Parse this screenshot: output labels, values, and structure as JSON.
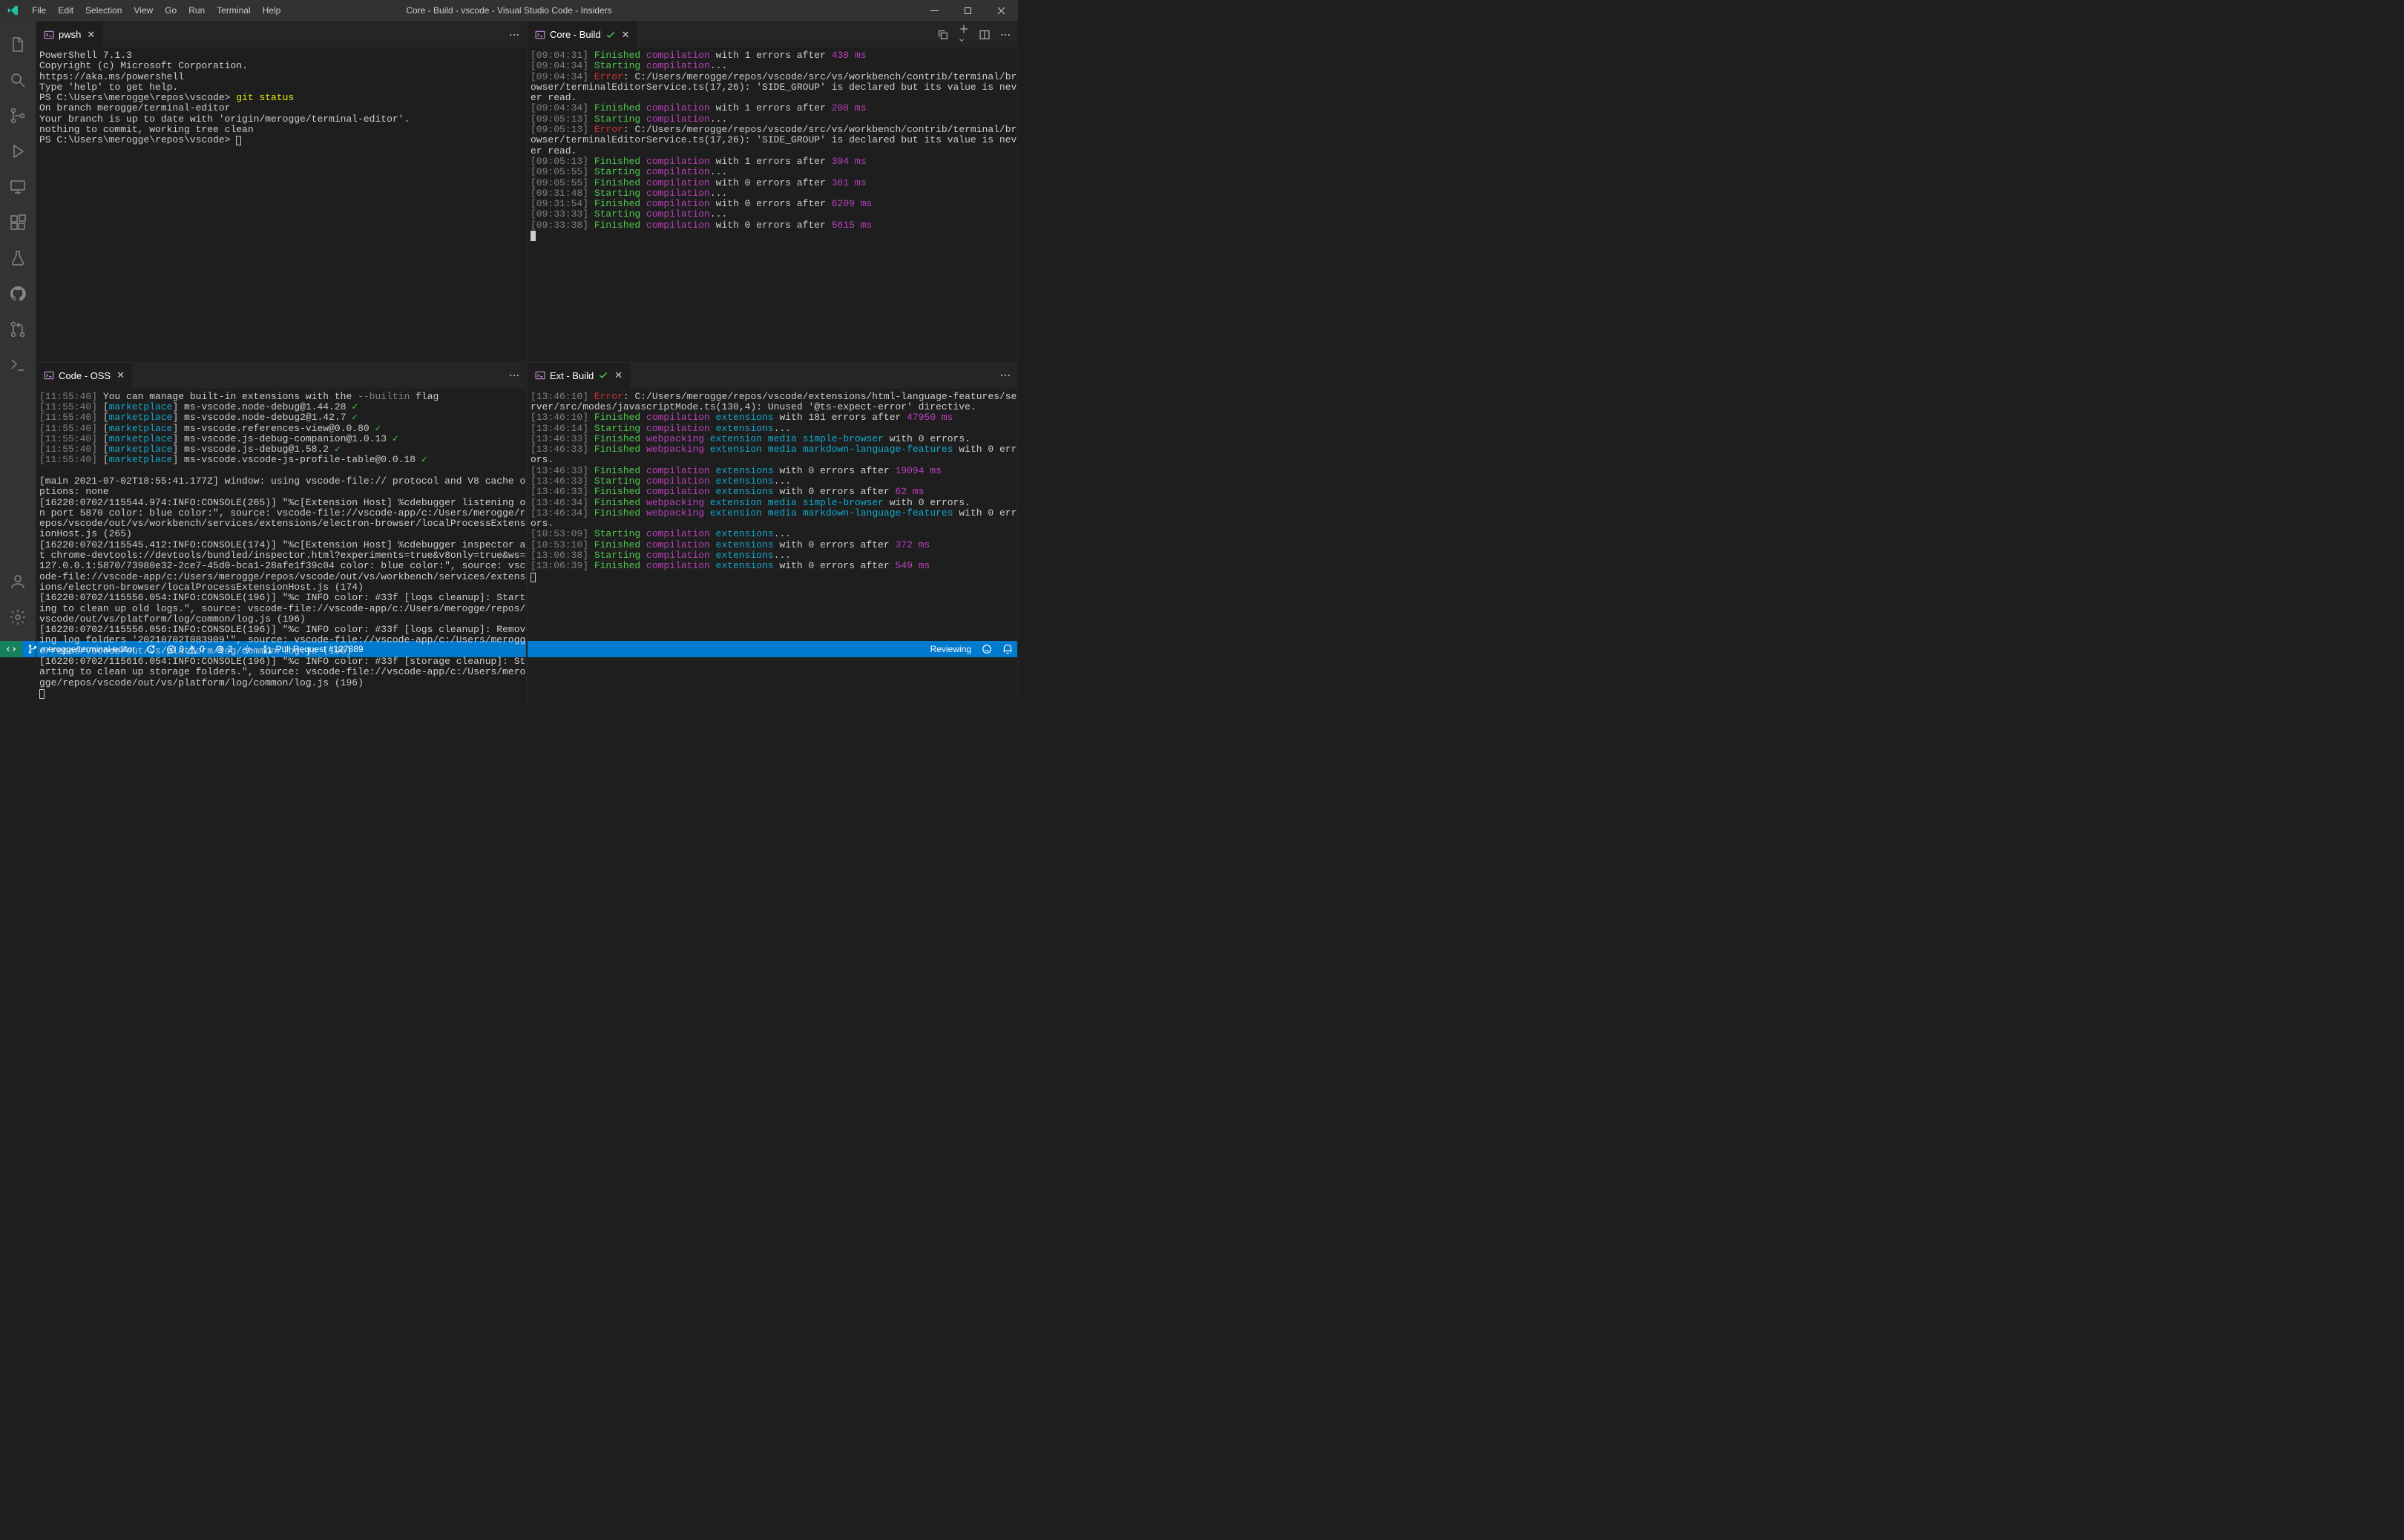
{
  "window": {
    "title": "Core - Build - vscode - Visual Studio Code - Insiders"
  },
  "menu": [
    "File",
    "Edit",
    "Selection",
    "View",
    "Go",
    "Run",
    "Terminal",
    "Help"
  ],
  "panes": {
    "tl": {
      "tab": "pwsh",
      "lines": [
        {
          "t": "PowerShell 7.1.3"
        },
        {
          "t": "Copyright (c) Microsoft Corporation."
        },
        {
          "t": ""
        },
        {
          "t": "https://aka.ms/powershell"
        },
        {
          "t": "Type 'help' to get help."
        },
        {
          "t": ""
        },
        {
          "prompt": "PS C:\\Users\\merogge\\repos\\vscode> ",
          "cmd": "git status"
        },
        {
          "t": "On branch merogge/terminal-editor"
        },
        {
          "t": "Your branch is up to date with 'origin/merogge/terminal-editor'."
        },
        {
          "t": ""
        },
        {
          "t": "nothing to commit, working tree clean"
        },
        {
          "prompt": "PS C:\\Users\\merogge\\repos\\vscode> ",
          "cursor": "outline"
        }
      ]
    },
    "tr": {
      "tab": "Core - Build",
      "lines": [
        {
          "ts": "09:04:31",
          "segs": [
            {
              "c": "green",
              "t": " Finished "
            },
            {
              "c": "magenta",
              "t": "compilation"
            },
            {
              "t": " with 1 errors after "
            },
            {
              "c": "magenta",
              "t": "438 ms"
            }
          ]
        },
        {
          "ts": "09:04:34",
          "segs": [
            {
              "c": "green",
              "t": " Starting "
            },
            {
              "c": "magenta",
              "t": "compilation"
            },
            {
              "t": "..."
            }
          ]
        },
        {
          "ts": "09:04:34",
          "segs": [
            {
              "t": " "
            },
            {
              "c": "red",
              "t": "Error"
            },
            {
              "t": ": C:/Users/merogge/repos/vscode/src/vs/workbench/contrib/terminal/browser/terminalEditorService.ts(17,26): 'SIDE_GROUP' is declared but its value is never read."
            }
          ]
        },
        {
          "ts": "09:04:34",
          "segs": [
            {
              "c": "green",
              "t": " Finished "
            },
            {
              "c": "magenta",
              "t": "compilation"
            },
            {
              "t": " with 1 errors after "
            },
            {
              "c": "magenta",
              "t": "208 ms"
            }
          ]
        },
        {
          "ts": "09:05:13",
          "segs": [
            {
              "c": "green",
              "t": " Starting "
            },
            {
              "c": "magenta",
              "t": "compilation"
            },
            {
              "t": "..."
            }
          ]
        },
        {
          "ts": "09:05:13",
          "segs": [
            {
              "t": " "
            },
            {
              "c": "red",
              "t": "Error"
            },
            {
              "t": ": C:/Users/merogge/repos/vscode/src/vs/workbench/contrib/terminal/browser/terminalEditorService.ts(17,26): 'SIDE_GROUP' is declared but its value is never read."
            }
          ]
        },
        {
          "ts": "09:05:13",
          "segs": [
            {
              "c": "green",
              "t": " Finished "
            },
            {
              "c": "magenta",
              "t": "compilation"
            },
            {
              "t": " with 1 errors after "
            },
            {
              "c": "magenta",
              "t": "394 ms"
            }
          ]
        },
        {
          "ts": "09:05:55",
          "segs": [
            {
              "c": "green",
              "t": " Starting "
            },
            {
              "c": "magenta",
              "t": "compilation"
            },
            {
              "t": "..."
            }
          ]
        },
        {
          "ts": "09:05:55",
          "segs": [
            {
              "c": "green",
              "t": " Finished "
            },
            {
              "c": "magenta",
              "t": "compilation"
            },
            {
              "t": " with 0 errors after "
            },
            {
              "c": "magenta",
              "t": "361 ms"
            }
          ]
        },
        {
          "ts": "09:31:48",
          "segs": [
            {
              "c": "green",
              "t": " Starting "
            },
            {
              "c": "magenta",
              "t": "compilation"
            },
            {
              "t": "..."
            }
          ]
        },
        {
          "ts": "09:31:54",
          "segs": [
            {
              "c": "green",
              "t": " Finished "
            },
            {
              "c": "magenta",
              "t": "compilation"
            },
            {
              "t": " with 0 errors after "
            },
            {
              "c": "magenta",
              "t": "6209 ms"
            }
          ]
        },
        {
          "ts": "09:33:33",
          "segs": [
            {
              "c": "green",
              "t": " Starting "
            },
            {
              "c": "magenta",
              "t": "compilation"
            },
            {
              "t": "..."
            }
          ]
        },
        {
          "ts": "09:33:38",
          "segs": [
            {
              "c": "green",
              "t": " Finished "
            },
            {
              "c": "magenta",
              "t": "compilation"
            },
            {
              "t": " with 0 errors after "
            },
            {
              "c": "magenta",
              "t": "5615 ms"
            }
          ]
        },
        {
          "cursor": "block"
        }
      ]
    },
    "bl": {
      "tab": "Code - OSS",
      "lines": [
        {
          "ts": "11:55:40",
          "segs": [
            {
              "t": " You can manage built-in extensions with the "
            },
            {
              "c": "gray",
              "t": "--builtin"
            },
            {
              "t": " flag"
            }
          ]
        },
        {
          "ts": "11:55:40",
          "segs": [
            {
              "t": " ["
            },
            {
              "c": "cyan",
              "t": "marketplace"
            },
            {
              "t": "] ms-vscode.node-debug@1.44.28 "
            },
            {
              "c": "green",
              "t": "✓"
            }
          ]
        },
        {
          "ts": "11:55:40",
          "segs": [
            {
              "t": " ["
            },
            {
              "c": "cyan",
              "t": "marketplace"
            },
            {
              "t": "] ms-vscode.node-debug2@1.42.7 "
            },
            {
              "c": "green",
              "t": "✓"
            }
          ]
        },
        {
          "ts": "11:55:40",
          "segs": [
            {
              "t": " ["
            },
            {
              "c": "cyan",
              "t": "marketplace"
            },
            {
              "t": "] ms-vscode.references-view@0.0.80 "
            },
            {
              "c": "green",
              "t": "✓"
            }
          ]
        },
        {
          "ts": "11:55:40",
          "segs": [
            {
              "t": " ["
            },
            {
              "c": "cyan",
              "t": "marketplace"
            },
            {
              "t": "] ms-vscode.js-debug-companion@1.0.13 "
            },
            {
              "c": "green",
              "t": "✓"
            }
          ]
        },
        {
          "ts": "11:55:40",
          "segs": [
            {
              "t": " ["
            },
            {
              "c": "cyan",
              "t": "marketplace"
            },
            {
              "t": "] ms-vscode.js-debug@1.58.2 "
            },
            {
              "c": "green",
              "t": "✓"
            }
          ]
        },
        {
          "ts": "11:55:40",
          "segs": [
            {
              "t": " ["
            },
            {
              "c": "cyan",
              "t": "marketplace"
            },
            {
              "t": "] ms-vscode.vscode-js-profile-table@0.0.18 "
            },
            {
              "c": "green",
              "t": "✓"
            }
          ]
        },
        {
          "segs": [
            {
              "t": " "
            }
          ]
        },
        {
          "segs": [
            {
              "t": "[main 2021-07-02T18:55:41.177Z] window: using vscode-file:// protocol and V8 cache options: none"
            }
          ]
        },
        {
          "segs": [
            {
              "t": "[16220:0702/115544.974:INFO:CONSOLE(265)] \"%c[Extension Host] %cdebugger listening on port 5870 color: blue color:\", source: vscode-file://vscode-app/c:/Users/merogge/repos/vscode/out/vs/workbench/services/extensions/electron-browser/localProcessExtensionHost.js (265)"
            }
          ]
        },
        {
          "segs": [
            {
              "t": "[16220:0702/115545.412:INFO:CONSOLE(174)] \"%c[Extension Host] %cdebugger inspector at chrome-devtools://devtools/bundled/inspector.html?experiments=true&v8only=true&ws=127.0.0.1:5870/73980e32-2ce7-45d0-bca1-28afe1f39c04 color: blue color:\", source: vscode-file://vscode-app/c:/Users/merogge/repos/vscode/out/vs/workbench/services/extensions/electron-browser/localProcessExtensionHost.js (174)"
            }
          ]
        },
        {
          "segs": [
            {
              "t": "[16220:0702/115556.054:INFO:CONSOLE(196)] \"%c INFO color: #33f [logs cleanup]: Starting to clean up old logs.\", source: vscode-file://vscode-app/c:/Users/merogge/repos/vscode/out/vs/platform/log/common/log.js (196)"
            }
          ]
        },
        {
          "segs": [
            {
              "t": "[16220:0702/115556.056:INFO:CONSOLE(196)] \"%c INFO color: #33f [logs cleanup]: Removing log folders '20210702T083909'\", source: vscode-file://vscode-app/c:/Users/merogge/repos/vscode/out/vs/platform/log/common/log.js (196)"
            }
          ]
        },
        {
          "segs": [
            {
              "t": "[16220:0702/115616.054:INFO:CONSOLE(196)] \"%c INFO color: #33f [storage cleanup]: Starting to clean up storage folders.\", source: vscode-file://vscode-app/c:/Users/merogge/repos/vscode/out/vs/platform/log/common/log.js (196)"
            }
          ]
        },
        {
          "cursor": "outline"
        }
      ]
    },
    "br": {
      "tab": "Ext - Build",
      "lines": [
        {
          "ts": "13:46:10",
          "segs": [
            {
              "t": " "
            },
            {
              "c": "red",
              "t": "Error"
            },
            {
              "t": ": C:/Users/merogge/repos/vscode/extensions/html-language-features/server/src/modes/javascriptMode.ts(130,4): Unused '@ts-expect-error' directive."
            }
          ]
        },
        {
          "ts": "13:46:10",
          "segs": [
            {
              "c": "green",
              "t": " Finished "
            },
            {
              "c": "magenta",
              "t": "compilation"
            },
            {
              "t": " "
            },
            {
              "c": "cyan",
              "t": "extensions"
            },
            {
              "t": " with 181 errors after "
            },
            {
              "c": "magenta",
              "t": "47950 ms"
            }
          ]
        },
        {
          "ts": "13:46:14",
          "segs": [
            {
              "c": "green",
              "t": " Starting "
            },
            {
              "c": "magenta",
              "t": "compilation"
            },
            {
              "t": " "
            },
            {
              "c": "cyan",
              "t": "extensions"
            },
            {
              "t": "..."
            }
          ]
        },
        {
          "ts": "13:46:33",
          "segs": [
            {
              "c": "green",
              "t": " Finished "
            },
            {
              "c": "magenta",
              "t": "webpacking"
            },
            {
              "t": " "
            },
            {
              "c": "cyan",
              "t": "extension"
            },
            {
              "t": " "
            },
            {
              "c": "cyan",
              "t": "media"
            },
            {
              "t": " "
            },
            {
              "c": "cyan",
              "t": "simple-browser"
            },
            {
              "t": " with 0 errors."
            }
          ]
        },
        {
          "ts": "13:46:33",
          "segs": [
            {
              "c": "green",
              "t": " Finished "
            },
            {
              "c": "magenta",
              "t": "webpacking"
            },
            {
              "t": " "
            },
            {
              "c": "cyan",
              "t": "extension"
            },
            {
              "t": " "
            },
            {
              "c": "cyan",
              "t": "media"
            },
            {
              "t": " "
            },
            {
              "c": "cyan",
              "t": "markdown-language-features"
            },
            {
              "t": " with 0 errors."
            }
          ]
        },
        {
          "ts": "13:46:33",
          "segs": [
            {
              "c": "green",
              "t": " Finished "
            },
            {
              "c": "magenta",
              "t": "compilation"
            },
            {
              "t": " "
            },
            {
              "c": "cyan",
              "t": "extensions"
            },
            {
              "t": " with 0 errors after "
            },
            {
              "c": "magenta",
              "t": "19094 ms"
            }
          ]
        },
        {
          "ts": "13:46:33",
          "segs": [
            {
              "c": "green",
              "t": " Starting "
            },
            {
              "c": "magenta",
              "t": "compilation"
            },
            {
              "t": " "
            },
            {
              "c": "cyan",
              "t": "extensions"
            },
            {
              "t": "..."
            }
          ]
        },
        {
          "ts": "13:46:33",
          "segs": [
            {
              "c": "green",
              "t": " Finished "
            },
            {
              "c": "magenta",
              "t": "compilation"
            },
            {
              "t": " "
            },
            {
              "c": "cyan",
              "t": "extensions"
            },
            {
              "t": " with 0 errors after "
            },
            {
              "c": "magenta",
              "t": "62 ms"
            }
          ]
        },
        {
          "ts": "13:46:34",
          "segs": [
            {
              "c": "green",
              "t": " Finished "
            },
            {
              "c": "magenta",
              "t": "webpacking"
            },
            {
              "t": " "
            },
            {
              "c": "cyan",
              "t": "extension"
            },
            {
              "t": " "
            },
            {
              "c": "cyan",
              "t": "media"
            },
            {
              "t": " "
            },
            {
              "c": "cyan",
              "t": "simple-browser"
            },
            {
              "t": " with 0 errors."
            }
          ]
        },
        {
          "ts": "13:46:34",
          "segs": [
            {
              "c": "green",
              "t": " Finished "
            },
            {
              "c": "magenta",
              "t": "webpacking"
            },
            {
              "t": " "
            },
            {
              "c": "cyan",
              "t": "extension"
            },
            {
              "t": " "
            },
            {
              "c": "cyan",
              "t": "media"
            },
            {
              "t": " "
            },
            {
              "c": "cyan",
              "t": "markdown-language-features"
            },
            {
              "t": " with 0 errors."
            }
          ]
        },
        {
          "ts": "10:53:09",
          "segs": [
            {
              "c": "green",
              "t": " Starting "
            },
            {
              "c": "magenta",
              "t": "compilation"
            },
            {
              "t": " "
            },
            {
              "c": "cyan",
              "t": "extensions"
            },
            {
              "t": "..."
            }
          ]
        },
        {
          "ts": "10:53:10",
          "segs": [
            {
              "c": "green",
              "t": " Finished "
            },
            {
              "c": "magenta",
              "t": "compilation"
            },
            {
              "t": " "
            },
            {
              "c": "cyan",
              "t": "extensions"
            },
            {
              "t": " with 0 errors after "
            },
            {
              "c": "magenta",
              "t": "372 ms"
            }
          ]
        },
        {
          "ts": "13:06:38",
          "segs": [
            {
              "c": "green",
              "t": " Starting "
            },
            {
              "c": "magenta",
              "t": "compilation"
            },
            {
              "t": " "
            },
            {
              "c": "cyan",
              "t": "extensions"
            },
            {
              "t": "..."
            }
          ]
        },
        {
          "ts": "13:06:39",
          "segs": [
            {
              "c": "green",
              "t": " Finished "
            },
            {
              "c": "magenta",
              "t": "compilation"
            },
            {
              "t": " "
            },
            {
              "c": "cyan",
              "t": "extensions"
            },
            {
              "t": " with 0 errors after "
            },
            {
              "c": "magenta",
              "t": "549 ms"
            }
          ]
        },
        {
          "cursor": "outline"
        }
      ]
    }
  },
  "status": {
    "branch": "merogge/terminal-editor",
    "sync": "",
    "errors": "0",
    "warnings": "0",
    "ports": "2",
    "pr": "Pull Request #127889",
    "reviewing": "Reviewing"
  }
}
